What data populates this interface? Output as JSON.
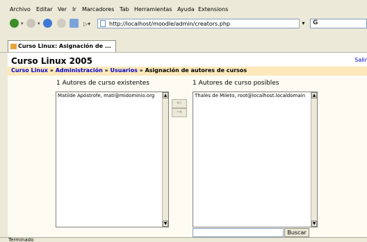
{
  "menu": [
    {
      "label": "Archivo"
    },
    {
      "label": "Editar"
    },
    {
      "label": "Ver"
    },
    {
      "label": "Ir"
    },
    {
      "label": "Marcadores"
    },
    {
      "label": "Tab"
    },
    {
      "label": "Herramientas"
    },
    {
      "label": "Ayuda"
    },
    {
      "label": "Extensions"
    }
  ],
  "navbar": {
    "url": "http://localhost/moodle/admin/creators.php",
    "search_value": "",
    "icons": [
      "back-icon",
      "forward-icon",
      "reload-icon",
      "stop-icon",
      "home-icon",
      "go-icon",
      "page-icon",
      "google-icon"
    ]
  },
  "tab": {
    "title": "Curso Linux: Asignación de ..."
  },
  "page": {
    "site_title": "Curso Linux 2005",
    "logout_link": "Salir",
    "breadcrumb": {
      "link1": "Curso Linux",
      "link2": "Administración",
      "link3": "Usuarios",
      "current": "Asignación de autores de cursos",
      "separator": "»"
    },
    "existing": {
      "label": "1 Autores de curso existentes",
      "items": [
        "Matilde Apóstrofe, mati@midominio.org"
      ]
    },
    "potential": {
      "label": "1 Autores de curso posibles",
      "items": [
        "Thales de Mileto, root@localhost.localdomain"
      ]
    },
    "add_arrow": "←",
    "remove_arrow": "→",
    "search_button": "Buscar",
    "search_value": ""
  },
  "status": {
    "text": "Terminado"
  },
  "colors": {
    "chrome": "#ece9d8",
    "page_bg": "#fdfbf2",
    "breadcrumb_bg": "#fce8bb",
    "link": "#0000cc"
  }
}
